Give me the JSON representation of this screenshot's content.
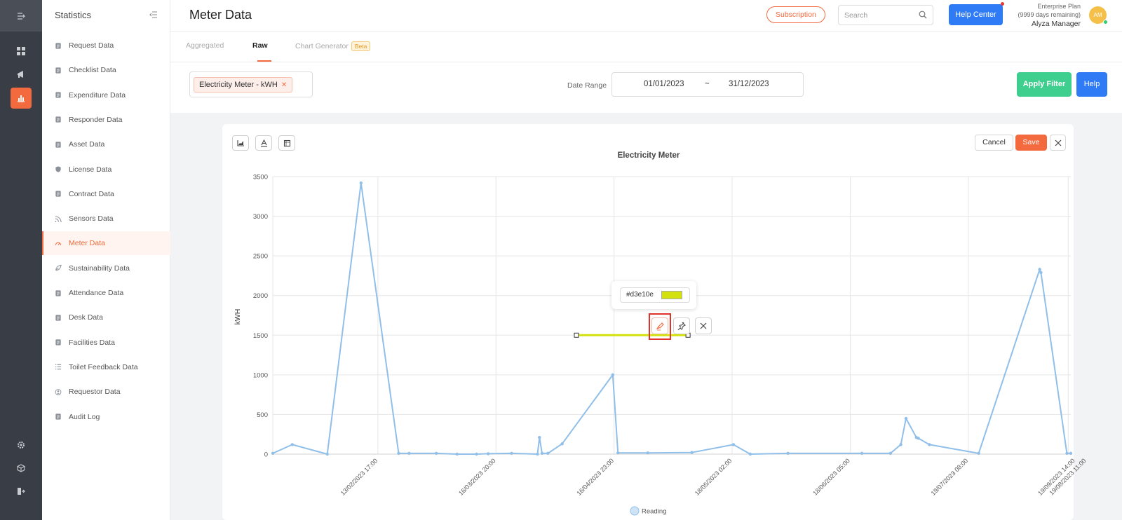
{
  "header": {
    "title": "Meter Data",
    "subscription_label": "Subscription",
    "search_placeholder": "Search",
    "help_center_label": "Help Center",
    "plan_name": "Enterprise Plan",
    "plan_remaining": "(9999 days remaining)",
    "user_name": "Alyza Manager",
    "avatar_initials": "AM"
  },
  "sidebar": {
    "title": "Statistics",
    "items": [
      {
        "label": "Request Data",
        "icon": "request-icon"
      },
      {
        "label": "Checklist Data",
        "icon": "checklist-icon"
      },
      {
        "label": "Expenditure Data",
        "icon": "wallet-icon"
      },
      {
        "label": "Responder Data",
        "icon": "responder-icon"
      },
      {
        "label": "Asset Data",
        "icon": "asset-icon"
      },
      {
        "label": "License Data",
        "icon": "shield-icon"
      },
      {
        "label": "Contract Data",
        "icon": "contract-icon"
      },
      {
        "label": "Sensors Data",
        "icon": "wifi-icon"
      },
      {
        "label": "Meter Data",
        "icon": "gauge-icon"
      },
      {
        "label": "Sustainability Data",
        "icon": "leaf-icon"
      },
      {
        "label": "Attendance Data",
        "icon": "calendar-check-icon"
      },
      {
        "label": "Desk Data",
        "icon": "desk-icon"
      },
      {
        "label": "Facilities Data",
        "icon": "facilities-icon"
      },
      {
        "label": "Toilet Feedback Data",
        "icon": "list-icon"
      },
      {
        "label": "Requestor Data",
        "icon": "requestor-icon"
      },
      {
        "label": "Audit Log",
        "icon": "audit-icon"
      }
    ],
    "active_index": 8
  },
  "tabs": {
    "items": [
      "Aggregated",
      "Raw",
      "Chart Generator"
    ],
    "beta_label": "Beta",
    "active": "Raw"
  },
  "filter": {
    "meter_chip": "Electricity Meter - kWH",
    "date_range_label": "Date Range",
    "date_start": "01/01/2023",
    "date_separator": "~",
    "date_end": "31/12/2023",
    "apply_label": "Apply Filter",
    "help_label": "Help"
  },
  "editor": {
    "cancel_label": "Cancel",
    "save_label": "Save",
    "annotation_color_hex": "#d3e10e"
  },
  "chart_data": {
    "type": "line",
    "title": "Electricity Meter",
    "xlabel": "",
    "ylabel": "kWH",
    "ylim": [
      0,
      3500
    ],
    "y_ticks": [
      0,
      500,
      1000,
      1500,
      2000,
      2500,
      3000,
      3500
    ],
    "x_tick_labels": [
      "13/02/2023 17:00",
      "16/03/2023 20:00",
      "16/04/2023 23:00",
      "18/05/2023 02:00",
      "18/06/2023 05:00",
      "19/07/2023 08:00",
      "19/08/2023 11:00",
      "19/09/2023 14:00"
    ],
    "legend_position": "bottom",
    "grid": true,
    "series": [
      {
        "name": "Reading",
        "color": "#90bfe9",
        "x": [
          0.0,
          1.5,
          4.2,
          6.8,
          9.7,
          10.5,
          12.6,
          14.2,
          15.7,
          16.6,
          18.4,
          20.4,
          20.55,
          20.75,
          21.2,
          22.3,
          26.2,
          26.6,
          28.9,
          32.3,
          35.5,
          36.8,
          39.7,
          45.4,
          47.6,
          48.4,
          48.8,
          49.6,
          49.75,
          50.6,
          54.4,
          59.1,
          59.2,
          61.2,
          61.5
        ],
        "y": [
          10,
          120,
          0,
          3420,
          10,
          10,
          10,
          0,
          0,
          5,
          10,
          0,
          210,
          10,
          10,
          130,
          1000,
          15,
          15,
          20,
          120,
          0,
          10,
          10,
          10,
          120,
          450,
          210,
          200,
          120,
          10,
          2330,
          2290,
          10,
          10
        ]
      }
    ],
    "annotations": [
      {
        "type": "horizontal-line",
        "y": 1500,
        "color": "#d3e10e"
      }
    ]
  }
}
